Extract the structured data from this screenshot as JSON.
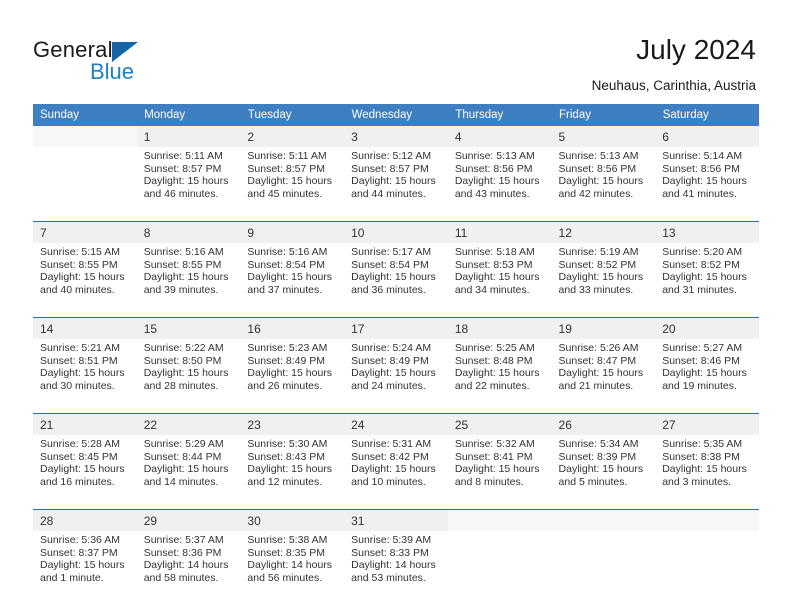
{
  "brand": {
    "name_top": "General",
    "name_bottom": "Blue",
    "triangle_color": "#1565a8",
    "blue_color": "#1d7fc4"
  },
  "header": {
    "title": "July 2024",
    "location": "Neuhaus, Carinthia, Austria"
  },
  "theme": {
    "header_blue": "#3d7fc1",
    "week_divider": "#2e6da4",
    "daynum_band": "#f0f0f0",
    "text": "#333333"
  },
  "weekday_headers": [
    "Sunday",
    "Monday",
    "Tuesday",
    "Wednesday",
    "Thursday",
    "Friday",
    "Saturday"
  ],
  "calendar": {
    "month": "July",
    "year": "2024",
    "weeks": [
      [
        {
          "day": "",
          "empty": true,
          "sunrise": "",
          "sunset": "",
          "daylight_line1": "",
          "daylight_line2": ""
        },
        {
          "day": "1",
          "sunrise": "Sunrise: 5:11 AM",
          "sunset": "Sunset: 8:57 PM",
          "daylight_line1": "Daylight: 15 hours",
          "daylight_line2": "and 46 minutes."
        },
        {
          "day": "2",
          "sunrise": "Sunrise: 5:11 AM",
          "sunset": "Sunset: 8:57 PM",
          "daylight_line1": "Daylight: 15 hours",
          "daylight_line2": "and 45 minutes."
        },
        {
          "day": "3",
          "sunrise": "Sunrise: 5:12 AM",
          "sunset": "Sunset: 8:57 PM",
          "daylight_line1": "Daylight: 15 hours",
          "daylight_line2": "and 44 minutes."
        },
        {
          "day": "4",
          "sunrise": "Sunrise: 5:13 AM",
          "sunset": "Sunset: 8:56 PM",
          "daylight_line1": "Daylight: 15 hours",
          "daylight_line2": "and 43 minutes."
        },
        {
          "day": "5",
          "sunrise": "Sunrise: 5:13 AM",
          "sunset": "Sunset: 8:56 PM",
          "daylight_line1": "Daylight: 15 hours",
          "daylight_line2": "and 42 minutes."
        },
        {
          "day": "6",
          "sunrise": "Sunrise: 5:14 AM",
          "sunset": "Sunset: 8:56 PM",
          "daylight_line1": "Daylight: 15 hours",
          "daylight_line2": "and 41 minutes."
        }
      ],
      [
        {
          "day": "7",
          "sunrise": "Sunrise: 5:15 AM",
          "sunset": "Sunset: 8:55 PM",
          "daylight_line1": "Daylight: 15 hours",
          "daylight_line2": "and 40 minutes."
        },
        {
          "day": "8",
          "sunrise": "Sunrise: 5:16 AM",
          "sunset": "Sunset: 8:55 PM",
          "daylight_line1": "Daylight: 15 hours",
          "daylight_line2": "and 39 minutes."
        },
        {
          "day": "9",
          "sunrise": "Sunrise: 5:16 AM",
          "sunset": "Sunset: 8:54 PM",
          "daylight_line1": "Daylight: 15 hours",
          "daylight_line2": "and 37 minutes."
        },
        {
          "day": "10",
          "sunrise": "Sunrise: 5:17 AM",
          "sunset": "Sunset: 8:54 PM",
          "daylight_line1": "Daylight: 15 hours",
          "daylight_line2": "and 36 minutes."
        },
        {
          "day": "11",
          "sunrise": "Sunrise: 5:18 AM",
          "sunset": "Sunset: 8:53 PM",
          "daylight_line1": "Daylight: 15 hours",
          "daylight_line2": "and 34 minutes."
        },
        {
          "day": "12",
          "sunrise": "Sunrise: 5:19 AM",
          "sunset": "Sunset: 8:52 PM",
          "daylight_line1": "Daylight: 15 hours",
          "daylight_line2": "and 33 minutes."
        },
        {
          "day": "13",
          "sunrise": "Sunrise: 5:20 AM",
          "sunset": "Sunset: 8:52 PM",
          "daylight_line1": "Daylight: 15 hours",
          "daylight_line2": "and 31 minutes."
        }
      ],
      [
        {
          "day": "14",
          "sunrise": "Sunrise: 5:21 AM",
          "sunset": "Sunset: 8:51 PM",
          "daylight_line1": "Daylight: 15 hours",
          "daylight_line2": "and 30 minutes."
        },
        {
          "day": "15",
          "sunrise": "Sunrise: 5:22 AM",
          "sunset": "Sunset: 8:50 PM",
          "daylight_line1": "Daylight: 15 hours",
          "daylight_line2": "and 28 minutes."
        },
        {
          "day": "16",
          "sunrise": "Sunrise: 5:23 AM",
          "sunset": "Sunset: 8:49 PM",
          "daylight_line1": "Daylight: 15 hours",
          "daylight_line2": "and 26 minutes."
        },
        {
          "day": "17",
          "sunrise": "Sunrise: 5:24 AM",
          "sunset": "Sunset: 8:49 PM",
          "daylight_line1": "Daylight: 15 hours",
          "daylight_line2": "and 24 minutes."
        },
        {
          "day": "18",
          "sunrise": "Sunrise: 5:25 AM",
          "sunset": "Sunset: 8:48 PM",
          "daylight_line1": "Daylight: 15 hours",
          "daylight_line2": "and 22 minutes."
        },
        {
          "day": "19",
          "sunrise": "Sunrise: 5:26 AM",
          "sunset": "Sunset: 8:47 PM",
          "daylight_line1": "Daylight: 15 hours",
          "daylight_line2": "and 21 minutes."
        },
        {
          "day": "20",
          "sunrise": "Sunrise: 5:27 AM",
          "sunset": "Sunset: 8:46 PM",
          "daylight_line1": "Daylight: 15 hours",
          "daylight_line2": "and 19 minutes."
        }
      ],
      [
        {
          "day": "21",
          "sunrise": "Sunrise: 5:28 AM",
          "sunset": "Sunset: 8:45 PM",
          "daylight_line1": "Daylight: 15 hours",
          "daylight_line2": "and 16 minutes."
        },
        {
          "day": "22",
          "sunrise": "Sunrise: 5:29 AM",
          "sunset": "Sunset: 8:44 PM",
          "daylight_line1": "Daylight: 15 hours",
          "daylight_line2": "and 14 minutes."
        },
        {
          "day": "23",
          "sunrise": "Sunrise: 5:30 AM",
          "sunset": "Sunset: 8:43 PM",
          "daylight_line1": "Daylight: 15 hours",
          "daylight_line2": "and 12 minutes."
        },
        {
          "day": "24",
          "sunrise": "Sunrise: 5:31 AM",
          "sunset": "Sunset: 8:42 PM",
          "daylight_line1": "Daylight: 15 hours",
          "daylight_line2": "and 10 minutes."
        },
        {
          "day": "25",
          "sunrise": "Sunrise: 5:32 AM",
          "sunset": "Sunset: 8:41 PM",
          "daylight_line1": "Daylight: 15 hours",
          "daylight_line2": "and 8 minutes."
        },
        {
          "day": "26",
          "sunrise": "Sunrise: 5:34 AM",
          "sunset": "Sunset: 8:39 PM",
          "daylight_line1": "Daylight: 15 hours",
          "daylight_line2": "and 5 minutes."
        },
        {
          "day": "27",
          "sunrise": "Sunrise: 5:35 AM",
          "sunset": "Sunset: 8:38 PM",
          "daylight_line1": "Daylight: 15 hours",
          "daylight_line2": "and 3 minutes."
        }
      ],
      [
        {
          "day": "28",
          "sunrise": "Sunrise: 5:36 AM",
          "sunset": "Sunset: 8:37 PM",
          "daylight_line1": "Daylight: 15 hours",
          "daylight_line2": "and 1 minute."
        },
        {
          "day": "29",
          "sunrise": "Sunrise: 5:37 AM",
          "sunset": "Sunset: 8:36 PM",
          "daylight_line1": "Daylight: 14 hours",
          "daylight_line2": "and 58 minutes."
        },
        {
          "day": "30",
          "sunrise": "Sunrise: 5:38 AM",
          "sunset": "Sunset: 8:35 PM",
          "daylight_line1": "Daylight: 14 hours",
          "daylight_line2": "and 56 minutes."
        },
        {
          "day": "31",
          "sunrise": "Sunrise: 5:39 AM",
          "sunset": "Sunset: 8:33 PM",
          "daylight_line1": "Daylight: 14 hours",
          "daylight_line2": "and 53 minutes."
        },
        {
          "day": "",
          "empty": true,
          "sunrise": "",
          "sunset": "",
          "daylight_line1": "",
          "daylight_line2": ""
        },
        {
          "day": "",
          "empty": true,
          "sunrise": "",
          "sunset": "",
          "daylight_line1": "",
          "daylight_line2": ""
        },
        {
          "day": "",
          "empty": true,
          "sunrise": "",
          "sunset": "",
          "daylight_line1": "",
          "daylight_line2": ""
        }
      ]
    ]
  }
}
